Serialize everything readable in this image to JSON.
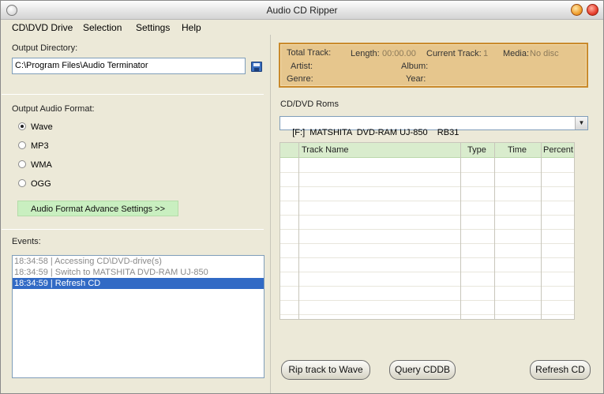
{
  "window": {
    "title": "Audio CD Ripper"
  },
  "menu": [
    "CD\\DVD Drive",
    "Selection",
    "Settings",
    "Help"
  ],
  "output": {
    "label": "Output Directory:",
    "path": "C:\\Program Files\\Audio Terminator",
    "save_icon": "floppy-disk"
  },
  "format": {
    "label": "Output Audio Format:",
    "options": [
      "Wave",
      "MP3",
      "WMA",
      "OGG"
    ],
    "selected": "Wave",
    "advance_button": "Audio Format Advance Settings >>"
  },
  "events": {
    "label": "Events:",
    "items": [
      "18:34:58 | Accessing CD\\DVD-drive(s)",
      "18:34:59 | Switch to MATSHITA DVD-RAM UJ-850",
      "18:34:59 | Refresh CD"
    ],
    "selected_index": 2
  },
  "info": {
    "total_track_label": "Total Track:",
    "length_label": "Length:",
    "length_value": "00:00.00",
    "current_track_label": "Current Track:",
    "current_track_value": "1",
    "media_label": "Media:",
    "media_value": "No disc",
    "artist_label": "Artist:",
    "album_label": "Album:",
    "genre_label": "Genre:",
    "year_label": "Year:"
  },
  "drives": {
    "label": "CD/DVD Roms",
    "selected": "[F:]  MATSHITA  DVD-RAM UJ-850    RB31"
  },
  "tracks": {
    "columns": [
      "Track Name",
      "Type",
      "Time",
      "Percent"
    ],
    "rows": []
  },
  "buttons": {
    "rip": "Rip track to Wave",
    "query": "Query CDDB",
    "refresh": "Refresh CD"
  }
}
